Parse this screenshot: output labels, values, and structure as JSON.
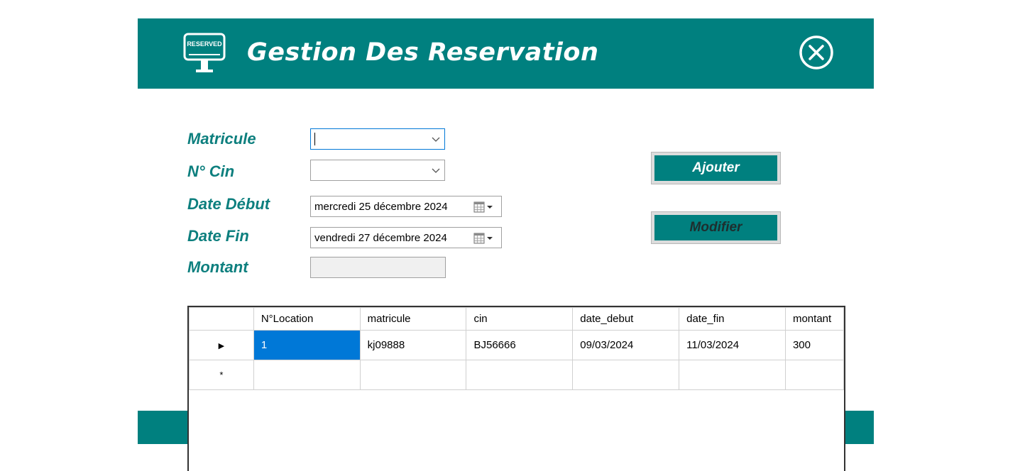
{
  "header": {
    "logo_text": "RESERVED",
    "title": "Gestion Des Reservation"
  },
  "form": {
    "matricule_label": "Matricule",
    "matricule_value": "",
    "cin_label": "N° Cin",
    "cin_value": "",
    "date_debut_label": "Date Début",
    "date_debut_value": "mercredi  25 décembre 2024",
    "date_fin_label": "Date Fin",
    "date_fin_value": "vendredi  27 décembre 2024",
    "montant_label": "Montant",
    "montant_value": ""
  },
  "buttons": {
    "ajouter": "Ajouter",
    "modifier": "Modifier"
  },
  "grid": {
    "columns": [
      "N°Location",
      "matricule",
      "cin",
      "date_debut",
      "date_fin",
      "montant"
    ],
    "rows": [
      [
        "1",
        "kj09888",
        "BJ56666",
        "09/03/2024",
        "11/03/2024",
        "300"
      ]
    ],
    "current_row_marker": "▶",
    "new_row_marker": "*"
  },
  "colors": {
    "accent": "#00807f",
    "label_text": "#0d7f7e",
    "selection": "#0078d7"
  }
}
